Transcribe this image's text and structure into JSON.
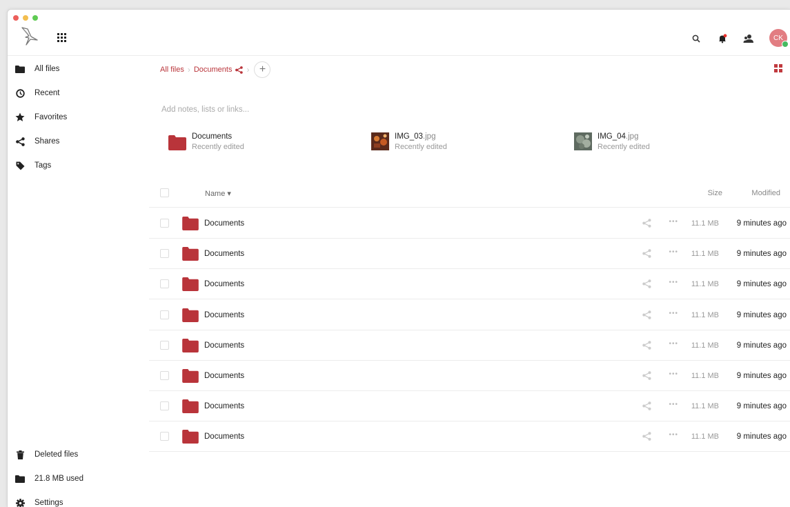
{
  "window": {
    "traffic_colors": [
      "#ec5f5b",
      "#f3be4f",
      "#5fcb53"
    ]
  },
  "header": {
    "app_icon": "nextcloud-bird-logo",
    "apps_icon": "apps-grid-icon",
    "search_icon": "search-icon",
    "notifications_icon": "bell-icon",
    "contacts_icon": "contacts-icon",
    "avatar_initials": "CK"
  },
  "sidebar": {
    "items": [
      {
        "label": "All files",
        "icon": "folder-icon"
      },
      {
        "label": "Recent",
        "icon": "clock-icon"
      },
      {
        "label": "Favorites",
        "icon": "star-icon"
      },
      {
        "label": "Shares",
        "icon": "share-icon"
      },
      {
        "label": "Tags",
        "icon": "tag-icon"
      }
    ],
    "bottom": [
      {
        "label": "Deleted files",
        "icon": "trash-icon"
      },
      {
        "label": "21.8 MB used",
        "icon": "folder-icon"
      },
      {
        "label": "Settings",
        "icon": "gear-icon"
      }
    ]
  },
  "breadcrumb": {
    "root": "All files",
    "current": "Documents",
    "add": "+"
  },
  "notes_placeholder": "Add notes, lists or links...",
  "recent_files": [
    {
      "name": "Documents",
      "ext": "",
      "subtitle": "Recently edited",
      "type": "folder"
    },
    {
      "name": "IMG_03",
      "ext": ".jpg",
      "subtitle": "Recently edited",
      "type": "image"
    },
    {
      "name": "IMG_04",
      "ext": ".jpg",
      "subtitle": "Recently edited",
      "type": "image"
    }
  ],
  "table": {
    "columns": {
      "name": "Name",
      "sort_indicator": "▾",
      "size": "Size",
      "modified": "Modified"
    },
    "rows": [
      {
        "name": "Documents",
        "size": "11.1 MB",
        "modified": "9 minutes ago"
      },
      {
        "name": "Documents",
        "size": "11.1 MB",
        "modified": "9 minutes ago"
      },
      {
        "name": "Documents",
        "size": "11.1 MB",
        "modified": "9 minutes ago"
      },
      {
        "name": "Documents",
        "size": "11.1 MB",
        "modified": "9 minutes ago"
      },
      {
        "name": "Documents",
        "size": "11.1 MB",
        "modified": "9 minutes ago"
      },
      {
        "name": "Documents",
        "size": "11.1 MB",
        "modified": "9 minutes ago"
      },
      {
        "name": "Documents",
        "size": "11.1 MB",
        "modified": "9 minutes ago"
      },
      {
        "name": "Documents",
        "size": "11.1 MB",
        "modified": "9 minutes ago"
      }
    ],
    "more_label": "•••"
  },
  "colors": {
    "accent": "#b9343a",
    "folder": "#b9343a"
  }
}
